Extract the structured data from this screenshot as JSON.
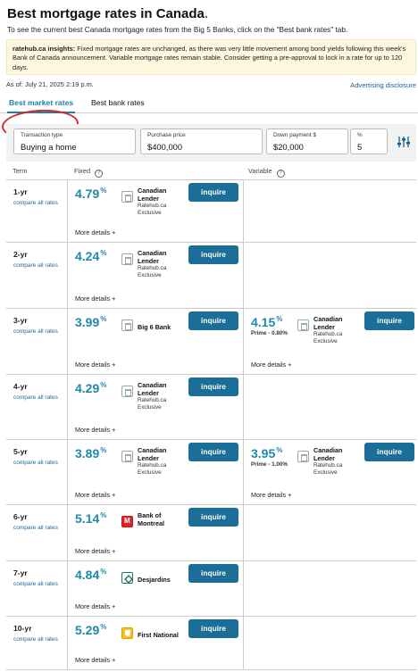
{
  "page": {
    "title": "Best mortgage rates in Canada",
    "title_dot": ".",
    "subtitle": "To see the current best Canada mortgage rates from the Big 5 Banks, click on the \"Best bank rates\" tab."
  },
  "insight": {
    "label": "ratehub.ca insights:",
    "text": " Fixed mortgage rates are unchanged, as there was very little movement among bond yields following this week's Bank of Canada announcement. Variable mortgage rates remain stable. Consider getting a pre-approval to lock in a rate for up to 120 days."
  },
  "as_of": "As of: July 21, 2025 2:19 p.m.",
  "advertising_link": "Advertising disclosure",
  "tabs": [
    {
      "label": "Best market rates",
      "active": true
    },
    {
      "label": "Best bank rates",
      "active": false
    }
  ],
  "filters": {
    "transaction_type": {
      "label": "Transaction type",
      "value": "Buying a home"
    },
    "purchase_price": {
      "label": "Purchase price",
      "value": "$400,000"
    },
    "down_payment": {
      "label": "Down payment $",
      "value": "$20,000"
    },
    "down_payment_pct": {
      "label": "%",
      "value": "5"
    },
    "settings_icon": "sliders-icon"
  },
  "columns": {
    "term": "Term",
    "fixed": "Fixed",
    "variable": "Variable",
    "help_icon": "?"
  },
  "compare_label": "compare all rates",
  "more_details_label": "More details +",
  "inquire_label": "inquire",
  "rows": [
    {
      "term": "1-yr",
      "fixed": {
        "rate": "4.79",
        "unit": "%",
        "lender": [
          "Canadian",
          "Lender"
        ],
        "sub": [
          "Ratehub.ca",
          "Exclusive"
        ],
        "logo": "generic"
      }
    },
    {
      "term": "2-yr",
      "fixed": {
        "rate": "4.24",
        "unit": "%",
        "lender": [
          "Canadian",
          "Lender"
        ],
        "sub": [
          "Ratehub.ca",
          "Exclusive"
        ],
        "logo": "generic"
      }
    },
    {
      "term": "3-yr",
      "fixed": {
        "rate": "3.99",
        "unit": "%",
        "lender": [
          "Big 6 Bank"
        ],
        "sub": [],
        "logo": "generic"
      },
      "variable": {
        "rate": "4.15",
        "unit": "%",
        "prime": "Prime - 0.80%",
        "lender": [
          "Canadian",
          "Lender"
        ],
        "sub": [
          "Ratehub.ca",
          "Exclusive"
        ],
        "logo": "generic"
      }
    },
    {
      "term": "4-yr",
      "fixed": {
        "rate": "4.29",
        "unit": "%",
        "lender": [
          "Canadian",
          "Lender"
        ],
        "sub": [
          "Ratehub.ca",
          "Exclusive"
        ],
        "logo": "generic"
      }
    },
    {
      "term": "5-yr",
      "fixed": {
        "rate": "3.89",
        "unit": "%",
        "lender": [
          "Canadian",
          "Lender"
        ],
        "sub": [
          "Ratehub.ca",
          "Exclusive"
        ],
        "logo": "generic"
      },
      "variable": {
        "rate": "3.95",
        "unit": "%",
        "prime": "Prime - 1.00%",
        "lender": [
          "Canadian",
          "Lender"
        ],
        "sub": [
          "Ratehub.ca",
          "Exclusive"
        ],
        "logo": "generic"
      }
    },
    {
      "term": "6-yr",
      "fixed": {
        "rate": "5.14",
        "unit": "%",
        "lender": [
          "Bank of",
          "Montreal"
        ],
        "sub": [],
        "logo": "bmo"
      }
    },
    {
      "term": "7-yr",
      "fixed": {
        "rate": "4.84",
        "unit": "%",
        "lender": [
          "Desjardins"
        ],
        "sub": [],
        "logo": "desjardins"
      }
    },
    {
      "term": "10-yr",
      "fixed": {
        "rate": "5.29",
        "unit": "%",
        "lender": [
          "First National"
        ],
        "sub": [],
        "logo": "first-national"
      }
    }
  ]
}
